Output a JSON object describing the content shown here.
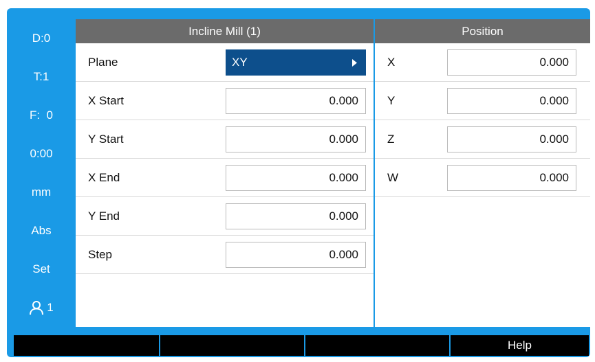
{
  "sidebar": {
    "items": [
      {
        "label": "D:0"
      },
      {
        "label": "T:1"
      },
      {
        "label": "F:  0"
      },
      {
        "label": "0:00"
      },
      {
        "label": "mm"
      },
      {
        "label": "Abs"
      },
      {
        "label": "Set"
      }
    ],
    "user": {
      "icon": "user-icon",
      "count": "1"
    }
  },
  "incline_mill": {
    "title": "Incline Mill (1)",
    "plane": {
      "label": "Plane",
      "value": "XY"
    },
    "rows": [
      {
        "label": "X Start",
        "value": "0.000"
      },
      {
        "label": "Y Start",
        "value": "0.000"
      },
      {
        "label": "X End",
        "value": "0.000"
      },
      {
        "label": "Y End",
        "value": "0.000"
      },
      {
        "label": "Step",
        "value": "0.000"
      }
    ]
  },
  "position": {
    "title": "Position",
    "axes": [
      {
        "label": "X",
        "value": "0.000"
      },
      {
        "label": "Y",
        "value": "0.000"
      },
      {
        "label": "Z",
        "value": "0.000"
      },
      {
        "label": "W",
        "value": "0.000"
      }
    ]
  },
  "softkeys": [
    "",
    "",
    "",
    "Help"
  ],
  "colors": {
    "frame": "#1a9ae6",
    "header": "#6b6b6b",
    "selected": "#0d4f8c",
    "softkey": "#000000"
  }
}
